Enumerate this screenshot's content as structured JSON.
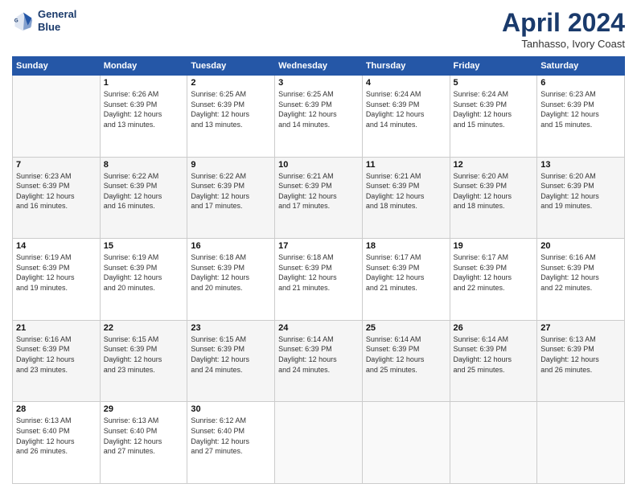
{
  "header": {
    "logo_line1": "General",
    "logo_line2": "Blue",
    "month": "April 2024",
    "location": "Tanhasso, Ivory Coast"
  },
  "weekdays": [
    "Sunday",
    "Monday",
    "Tuesday",
    "Wednesday",
    "Thursday",
    "Friday",
    "Saturday"
  ],
  "weeks": [
    [
      {
        "day": "",
        "info": ""
      },
      {
        "day": "1",
        "info": "Sunrise: 6:26 AM\nSunset: 6:39 PM\nDaylight: 12 hours\nand 13 minutes."
      },
      {
        "day": "2",
        "info": "Sunrise: 6:25 AM\nSunset: 6:39 PM\nDaylight: 12 hours\nand 13 minutes."
      },
      {
        "day": "3",
        "info": "Sunrise: 6:25 AM\nSunset: 6:39 PM\nDaylight: 12 hours\nand 14 minutes."
      },
      {
        "day": "4",
        "info": "Sunrise: 6:24 AM\nSunset: 6:39 PM\nDaylight: 12 hours\nand 14 minutes."
      },
      {
        "day": "5",
        "info": "Sunrise: 6:24 AM\nSunset: 6:39 PM\nDaylight: 12 hours\nand 15 minutes."
      },
      {
        "day": "6",
        "info": "Sunrise: 6:23 AM\nSunset: 6:39 PM\nDaylight: 12 hours\nand 15 minutes."
      }
    ],
    [
      {
        "day": "7",
        "info": "Sunrise: 6:23 AM\nSunset: 6:39 PM\nDaylight: 12 hours\nand 16 minutes."
      },
      {
        "day": "8",
        "info": "Sunrise: 6:22 AM\nSunset: 6:39 PM\nDaylight: 12 hours\nand 16 minutes."
      },
      {
        "day": "9",
        "info": "Sunrise: 6:22 AM\nSunset: 6:39 PM\nDaylight: 12 hours\nand 17 minutes."
      },
      {
        "day": "10",
        "info": "Sunrise: 6:21 AM\nSunset: 6:39 PM\nDaylight: 12 hours\nand 17 minutes."
      },
      {
        "day": "11",
        "info": "Sunrise: 6:21 AM\nSunset: 6:39 PM\nDaylight: 12 hours\nand 18 minutes."
      },
      {
        "day": "12",
        "info": "Sunrise: 6:20 AM\nSunset: 6:39 PM\nDaylight: 12 hours\nand 18 minutes."
      },
      {
        "day": "13",
        "info": "Sunrise: 6:20 AM\nSunset: 6:39 PM\nDaylight: 12 hours\nand 19 minutes."
      }
    ],
    [
      {
        "day": "14",
        "info": "Sunrise: 6:19 AM\nSunset: 6:39 PM\nDaylight: 12 hours\nand 19 minutes."
      },
      {
        "day": "15",
        "info": "Sunrise: 6:19 AM\nSunset: 6:39 PM\nDaylight: 12 hours\nand 20 minutes."
      },
      {
        "day": "16",
        "info": "Sunrise: 6:18 AM\nSunset: 6:39 PM\nDaylight: 12 hours\nand 20 minutes."
      },
      {
        "day": "17",
        "info": "Sunrise: 6:18 AM\nSunset: 6:39 PM\nDaylight: 12 hours\nand 21 minutes."
      },
      {
        "day": "18",
        "info": "Sunrise: 6:17 AM\nSunset: 6:39 PM\nDaylight: 12 hours\nand 21 minutes."
      },
      {
        "day": "19",
        "info": "Sunrise: 6:17 AM\nSunset: 6:39 PM\nDaylight: 12 hours\nand 22 minutes."
      },
      {
        "day": "20",
        "info": "Sunrise: 6:16 AM\nSunset: 6:39 PM\nDaylight: 12 hours\nand 22 minutes."
      }
    ],
    [
      {
        "day": "21",
        "info": "Sunrise: 6:16 AM\nSunset: 6:39 PM\nDaylight: 12 hours\nand 23 minutes."
      },
      {
        "day": "22",
        "info": "Sunrise: 6:15 AM\nSunset: 6:39 PM\nDaylight: 12 hours\nand 23 minutes."
      },
      {
        "day": "23",
        "info": "Sunrise: 6:15 AM\nSunset: 6:39 PM\nDaylight: 12 hours\nand 24 minutes."
      },
      {
        "day": "24",
        "info": "Sunrise: 6:14 AM\nSunset: 6:39 PM\nDaylight: 12 hours\nand 24 minutes."
      },
      {
        "day": "25",
        "info": "Sunrise: 6:14 AM\nSunset: 6:39 PM\nDaylight: 12 hours\nand 25 minutes."
      },
      {
        "day": "26",
        "info": "Sunrise: 6:14 AM\nSunset: 6:39 PM\nDaylight: 12 hours\nand 25 minutes."
      },
      {
        "day": "27",
        "info": "Sunrise: 6:13 AM\nSunset: 6:39 PM\nDaylight: 12 hours\nand 26 minutes."
      }
    ],
    [
      {
        "day": "28",
        "info": "Sunrise: 6:13 AM\nSunset: 6:40 PM\nDaylight: 12 hours\nand 26 minutes."
      },
      {
        "day": "29",
        "info": "Sunrise: 6:13 AM\nSunset: 6:40 PM\nDaylight: 12 hours\nand 27 minutes."
      },
      {
        "day": "30",
        "info": "Sunrise: 6:12 AM\nSunset: 6:40 PM\nDaylight: 12 hours\nand 27 minutes."
      },
      {
        "day": "",
        "info": ""
      },
      {
        "day": "",
        "info": ""
      },
      {
        "day": "",
        "info": ""
      },
      {
        "day": "",
        "info": ""
      }
    ]
  ]
}
